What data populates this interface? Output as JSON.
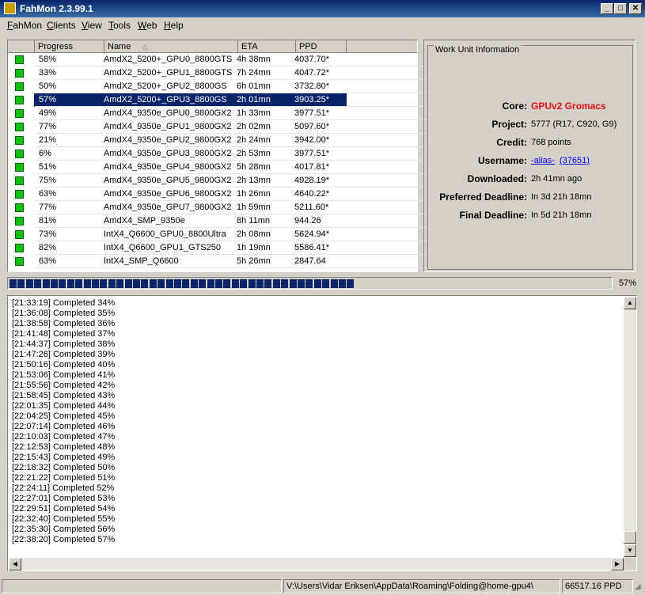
{
  "window": {
    "title": "FahMon 2.3.99.1"
  },
  "menu": [
    {
      "label": "FahMon",
      "mn": "F"
    },
    {
      "label": "Clients",
      "mn": "C"
    },
    {
      "label": "View",
      "mn": "V"
    },
    {
      "label": "Tools",
      "mn": "T"
    },
    {
      "label": "Web",
      "mn": "W"
    },
    {
      "label": "Help",
      "mn": "H"
    }
  ],
  "columns": [
    "",
    "Progress",
    "Name",
    "ETA",
    "PPD"
  ],
  "clients": [
    {
      "progress": "58%",
      "name": "AmdX2_5200+_GPU0_8800GTS",
      "eta": "4h 38mn",
      "ppd": "4037.70*"
    },
    {
      "progress": "33%",
      "name": "AmdX2_5200+_GPU1_8800GTS",
      "eta": "7h 24mn",
      "ppd": "4047.72*"
    },
    {
      "progress": "50%",
      "name": "AmdX2_5200+_GPU2_8800GS",
      "eta": "6h 01mn",
      "ppd": "3732.80*"
    },
    {
      "progress": "57%",
      "name": "AmdX2_5200+_GPU3_8800GS",
      "eta": "2h 01mn",
      "ppd": "3903.25*"
    },
    {
      "progress": "49%",
      "name": "AmdX4_9350e_GPU0_9800GX2",
      "eta": "1h 33mn",
      "ppd": "3977.51*"
    },
    {
      "progress": "77%",
      "name": "AmdX4_9350e_GPU1_9800GX2",
      "eta": "2h 02mn",
      "ppd": "5097.60*"
    },
    {
      "progress": "21%",
      "name": "AmdX4_9350e_GPU2_9800GX2",
      "eta": "2h 24mn",
      "ppd": "3942.00*"
    },
    {
      "progress": "6%",
      "name": "AmdX4_9350e_GPU3_9800GX2",
      "eta": "2h 53mn",
      "ppd": "3977.51*"
    },
    {
      "progress": "51%",
      "name": "AmdX4_9350e_GPU4_9800GX2",
      "eta": "5h 28mn",
      "ppd": "4017.81*"
    },
    {
      "progress": "75%",
      "name": "AmdX4_9350e_GPU5_9800GX2",
      "eta": "2h 13mn",
      "ppd": "4928.19*"
    },
    {
      "progress": "63%",
      "name": "AmdX4_9350e_GPU6_9800GX2",
      "eta": "1h 26mn",
      "ppd": "4640.22*"
    },
    {
      "progress": "77%",
      "name": "AmdX4_9350e_GPU7_9800GX2",
      "eta": "1h 59mn",
      "ppd": "5211.60*"
    },
    {
      "progress": "81%",
      "name": "AmdX4_SMP_9350e",
      "eta": "8h 11mn",
      "ppd": "944.26"
    },
    {
      "progress": "73%",
      "name": "IntX4_Q6600_GPU0_8800Ultra",
      "eta": "2h 08mn",
      "ppd": "5624.94*"
    },
    {
      "progress": "82%",
      "name": "IntX4_Q6600_GPU1_GTS250",
      "eta": "1h 19mn",
      "ppd": "5586.41*"
    },
    {
      "progress": "63%",
      "name": "IntX4_SMP_Q6600",
      "eta": "5h 26mn",
      "ppd": "2847.64"
    }
  ],
  "selected_index": 3,
  "workunit": {
    "title": "Work Unit Information",
    "fields": [
      {
        "label": "Core:",
        "value": "GPUv2 Gromacs"
      },
      {
        "label": "Project:",
        "value": "5777 (R17, C920, G9)"
      },
      {
        "label": "Credit:",
        "value": "768 points"
      },
      {
        "label": "Username:",
        "value": "-alias-",
        "link2": "(37651)"
      },
      {
        "label": "Downloaded:",
        "value": "2h 41mn ago"
      },
      {
        "label": "Preferred Deadline:",
        "value": "In 3d 21h 18mn"
      },
      {
        "label": "Final Deadline:",
        "value": "In 5d 21h 18mn"
      }
    ],
    "core_color": "#e01010",
    "link_color": "#0000ff"
  },
  "progress": {
    "percent_text": "57%",
    "fraction": 0.57
  },
  "log": [
    "[21:33:19] Completed 34%",
    "[21:36:08] Completed 35%",
    "[21:38:58] Completed 36%",
    "[21:41:48] Completed 37%",
    "[21:44:37] Completed 38%",
    "[21:47:26] Completed 39%",
    "[21:50:16] Completed 40%",
    "[21:53:06] Completed 41%",
    "[21:55:56] Completed 42%",
    "[21:58:45] Completed 43%",
    "[22:01:35] Completed 44%",
    "[22:04:25] Completed 45%",
    "[22:07:14] Completed 46%",
    "[22:10:03] Completed 47%",
    "[22:12:53] Completed 48%",
    "[22:15:43] Completed 49%",
    "[22:18:32] Completed 50%",
    "[22:21:22] Completed 51%",
    "[22:24:11] Completed 52%",
    "[22:27:01] Completed 53%",
    "[22:29:51] Completed 54%",
    "[22:32:40] Completed 55%",
    "[22:35:30] Completed 56%",
    "[22:38:20] Completed 57%"
  ],
  "status": {
    "path": "V:\\Users\\Vidar Eriksen\\AppData\\Roaming\\Folding@home-gpu4\\",
    "total_ppd": "66517.16 PPD"
  },
  "icons": {
    "minimize": "minimize-icon",
    "maximize": "maximize-icon",
    "close": "close-icon",
    "status": "green-square-icon"
  }
}
